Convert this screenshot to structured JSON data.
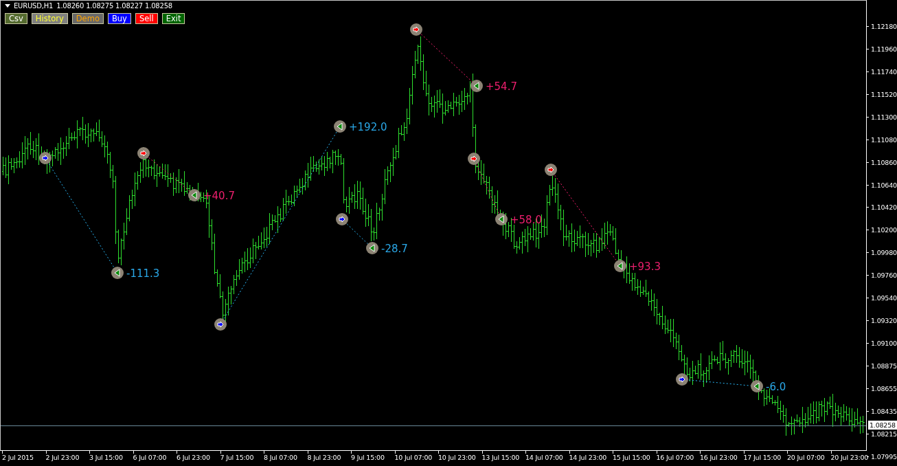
{
  "chart_header": {
    "symbol": "EURUSD,H1",
    "quotes": [
      "1.08260",
      "1.08275",
      "1.08227",
      "1.08258"
    ]
  },
  "buttons": [
    {
      "label": "Csv",
      "kind": "export"
    },
    {
      "label": "History",
      "kind": "history"
    },
    {
      "label": "Demo",
      "kind": "mode"
    },
    {
      "label": "Buy",
      "kind": "buy"
    },
    {
      "label": "Sell",
      "kind": "sell"
    },
    {
      "label": "Exit",
      "kind": "exit"
    }
  ],
  "trades": [
    {
      "kind": "buy",
      "result": "-111.3"
    },
    {
      "kind": "sell",
      "result": "+40.7"
    },
    {
      "kind": "buy",
      "result": "+192.0"
    },
    {
      "kind": "buy",
      "result": "-28.7"
    },
    {
      "kind": "sell",
      "result": "+54.7"
    },
    {
      "kind": "sell",
      "result": "+58.0"
    },
    {
      "kind": "sell",
      "result": "+93.3"
    },
    {
      "kind": "buy",
      "result": "-6.0"
    }
  ],
  "price_axis": [
    "1.12180",
    "1.11960",
    "1.11740",
    "1.11520",
    "1.11300",
    "1.11080",
    "1.10860",
    "1.10640",
    "1.10420",
    "1.10200",
    "1.09980",
    "1.09760",
    "1.09540",
    "1.09320",
    "1.09100",
    "1.08875",
    "1.08655",
    "1.08435",
    "1.08215",
    "1.07995"
  ],
  "current_price": "1.08258",
  "time_axis": [
    "2 Jul 2015",
    "2 Jul 23:00",
    "3 Jul 15:00",
    "6 Jul 07:00",
    "6 Jul 23:00",
    "7 Jul 15:00",
    "8 Jul 07:00",
    "8 Jul 23:00",
    "9 Jul 15:00",
    "10 Jul 07:00",
    "10 Jul 23:00",
    "13 Jul 15:00",
    "14 Jul 07:00",
    "14 Jul 23:00",
    "15 Jul 15:00",
    "16 Jul 07:00",
    "16 Jul 23:00",
    "17 Jul 15:00",
    "20 Jul 07:00",
    "20 Jul 23:00"
  ]
}
